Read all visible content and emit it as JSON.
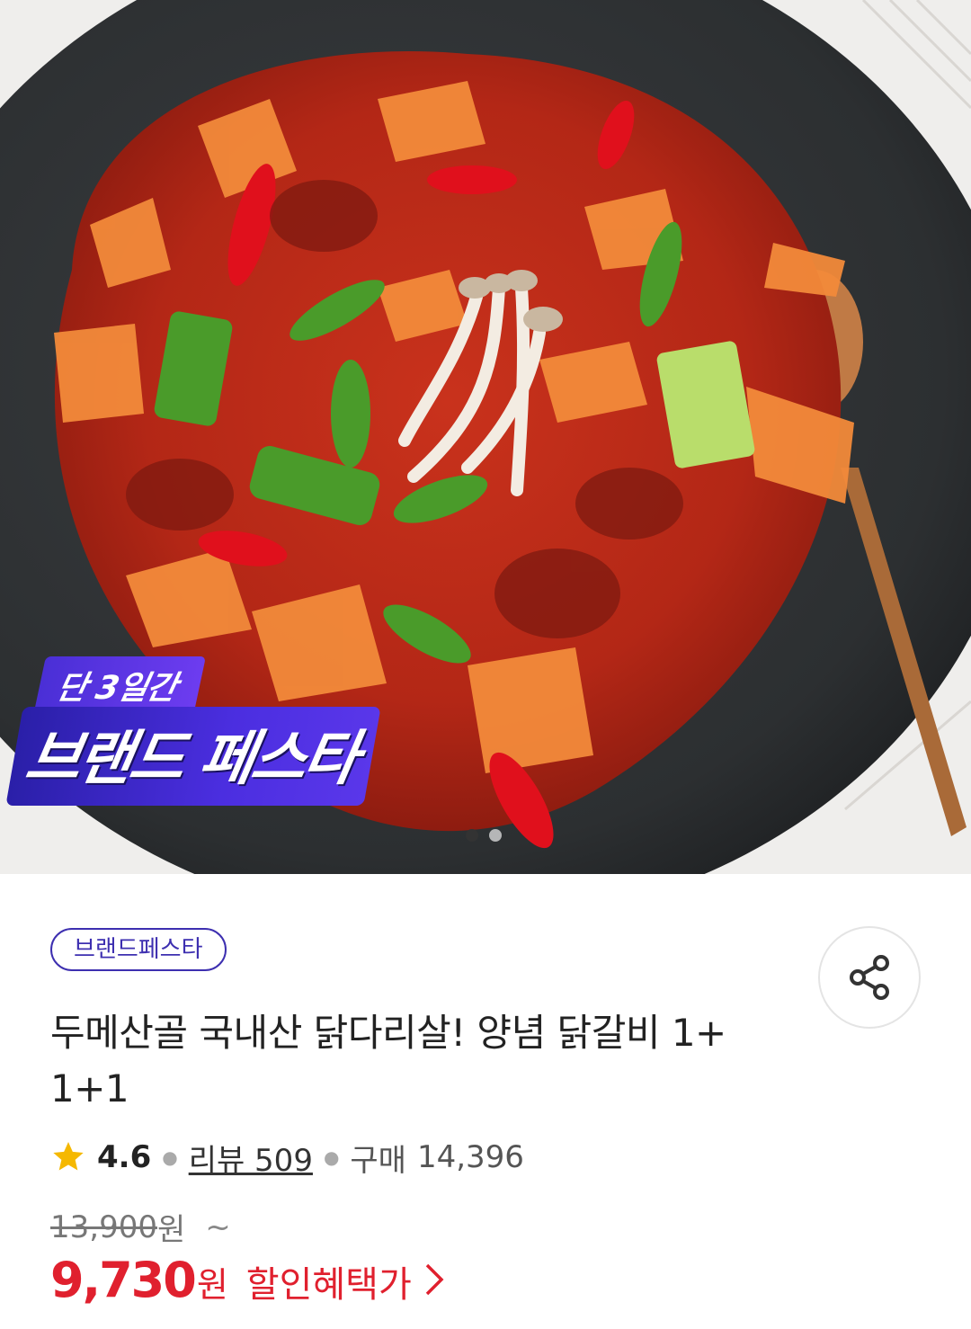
{
  "hero": {
    "promo_sub": "단 3일간",
    "promo_main": "브랜드 페스타",
    "pager_total": 2,
    "pager_active": 1
  },
  "product": {
    "badge": "브랜드페스타",
    "title_line1": "두메산골 국내산 닭다리살! 양념 닭갈비 1+",
    "title_line2": "1+1",
    "rating": "4.6",
    "review_label": "리뷰 509",
    "buy_label": "구매",
    "buy_count": "14,396",
    "original_price": "13,900",
    "original_unit": "원",
    "tilde": "~",
    "sale_price": "9,730",
    "sale_unit": "원",
    "sale_label": "할인혜택가"
  },
  "colors": {
    "accent_purple": "#3d2fb0",
    "sale_red": "#e0202e",
    "star_yellow": "#f5b800"
  },
  "icons": {
    "share": "share-icon",
    "star": "star-icon",
    "chevron": "chevron-right-icon"
  }
}
